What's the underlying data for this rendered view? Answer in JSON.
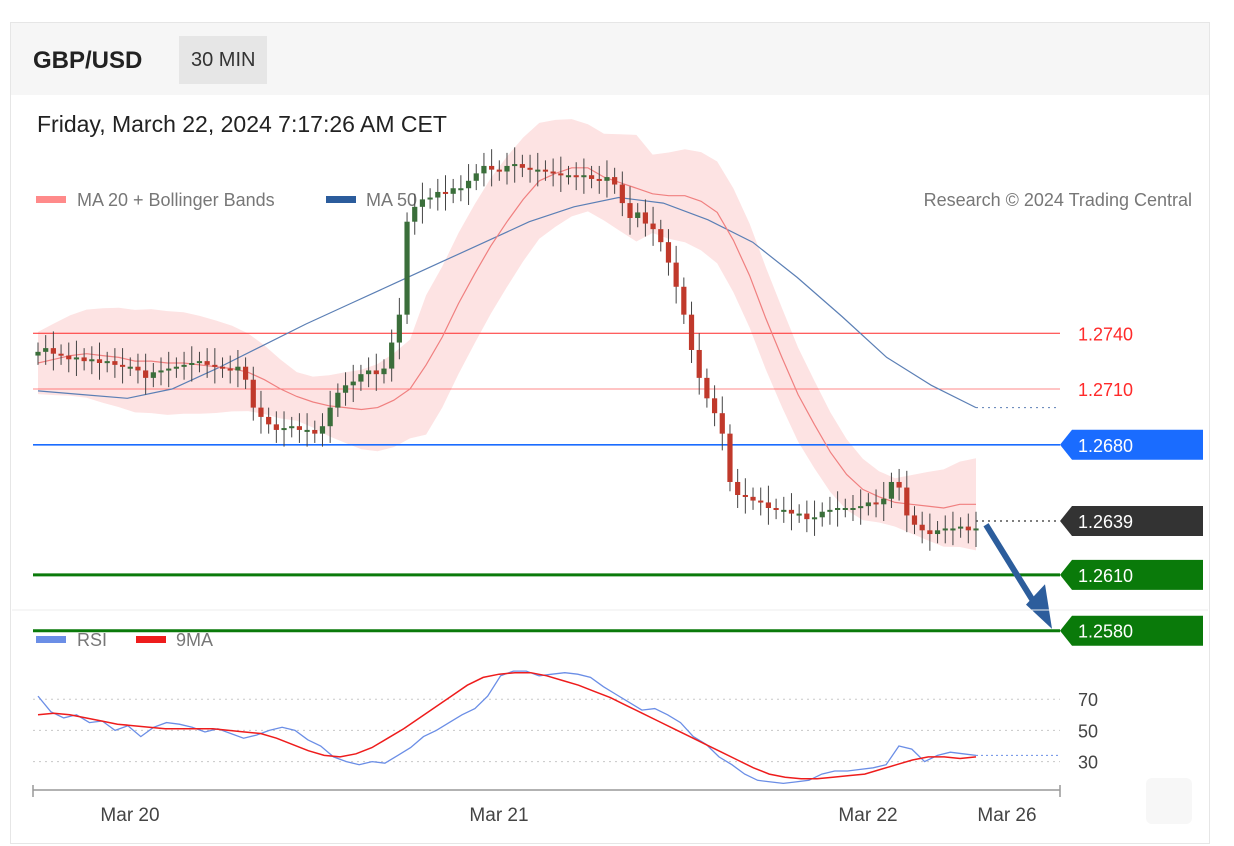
{
  "header": {
    "pair": "GBP/USD",
    "timeframe": "30 MIN",
    "datetime": "Friday, March 22, 2024 7:17:26 AM CET"
  },
  "legend": {
    "ma20": "MA 20 + Bollinger Bands",
    "ma50": "MA 50",
    "copyright": "Research © 2024 Trading Central",
    "rsi": "RSI",
    "rsi_ma": "9MA"
  },
  "colors": {
    "bollinger_fill": "#fde3e3",
    "ma20": "#f08080",
    "ma50": "#5b7fb5",
    "candle_up": "#3a6e3a",
    "candle_down": "#c0392b",
    "resistance": "#ff2a2a",
    "pivot": "#1a6cff",
    "support": "#0a7a0a",
    "current": "#333333",
    "arrow": "#2c5d9c",
    "rsi": "#6b8ee6",
    "rsi_ma": "#ee1c1c"
  },
  "chart_data": [
    {
      "type": "candlestick",
      "title": "GBP/USD",
      "timeframe": "30 MIN",
      "x_labels": [
        "Mar 20",
        "Mar 21",
        "Mar 22",
        "Mar 26"
      ],
      "ylim": [
        1.2575,
        1.2795
      ],
      "levels": [
        {
          "label": "1.2740",
          "value": 1.274,
          "kind": "resistance"
        },
        {
          "label": "1.2710",
          "value": 1.271,
          "kind": "resistance"
        },
        {
          "label": "1.2680",
          "value": 1.268,
          "kind": "pivot"
        },
        {
          "label": "1.2639",
          "value": 1.2639,
          "kind": "current"
        },
        {
          "label": "1.2610",
          "value": 1.261,
          "kind": "support"
        },
        {
          "label": "1.2580",
          "value": 1.258,
          "kind": "support"
        }
      ],
      "close_series": [
        1.273,
        1.2732,
        1.2729,
        1.2728,
        1.2726,
        1.2727,
        1.2725,
        1.2726,
        1.2724,
        1.2725,
        1.2723,
        1.2722,
        1.2722,
        1.272,
        1.2716,
        1.2719,
        1.272,
        1.2721,
        1.2722,
        1.2723,
        1.2724,
        1.2725,
        1.2723,
        1.2722,
        1.2721,
        1.272,
        1.2722,
        1.2715,
        1.27,
        1.2695,
        1.2691,
        1.2688,
        1.2689,
        1.269,
        1.2688,
        1.2688,
        1.2686,
        1.269,
        1.27,
        1.2708,
        1.2712,
        1.2714,
        1.2718,
        1.272,
        1.2718,
        1.2721,
        1.2735,
        1.275,
        1.28,
        1.2808,
        1.2812,
        1.2813,
        1.2816,
        1.2815,
        1.2818,
        1.2818,
        1.2822,
        1.2826,
        1.283,
        1.2828,
        1.2827,
        1.283,
        1.2831,
        1.2829,
        1.2828,
        1.2828,
        1.2827,
        1.2826,
        1.2825,
        1.2825,
        1.2824,
        1.2825,
        1.2823,
        1.2822,
        1.2824,
        1.282,
        1.281,
        1.2802,
        1.2805,
        1.2799,
        1.2796,
        1.2789,
        1.2778,
        1.2765,
        1.275,
        1.2731,
        1.2716,
        1.2705,
        1.2697,
        1.2686,
        1.266,
        1.2653,
        1.2652,
        1.265,
        1.2649,
        1.2646,
        1.2645,
        1.2645,
        1.2643,
        1.2643,
        1.264,
        1.2641,
        1.2644,
        1.2645,
        1.2646,
        1.2646,
        1.2646,
        1.2647,
        1.2649,
        1.2648,
        1.2651,
        1.266,
        1.2657,
        1.2642,
        1.2637,
        1.2634,
        1.2632,
        1.2634,
        1.2635,
        1.2635,
        1.2636,
        1.2634,
        1.2635
      ],
      "ma20": [
        1.2724,
        1.2726,
        1.2728,
        1.2729,
        1.2728,
        1.2727,
        1.2725,
        1.2725,
        1.2724,
        1.2724,
        1.2723,
        1.2722,
        1.2721,
        1.2719,
        1.2715,
        1.271,
        1.2706,
        1.2703,
        1.2701,
        1.27,
        1.2699,
        1.27,
        1.2704,
        1.271,
        1.2723,
        1.2738,
        1.2756,
        1.2772,
        1.2787,
        1.28,
        1.2812,
        1.2822,
        1.2826,
        1.2829,
        1.2829,
        1.2824,
        1.2821,
        1.2818,
        1.2815,
        1.2814,
        1.2814,
        1.2811,
        1.2805,
        1.279,
        1.2771,
        1.2748,
        1.2727,
        1.2707,
        1.2691,
        1.2676,
        1.2664,
        1.2656,
        1.2652,
        1.2649,
        1.2648,
        1.2647,
        1.2646,
        1.2648,
        1.2648
      ],
      "ma50": [
        1.2709,
        1.2707,
        1.2705,
        1.271,
        1.2721,
        1.2733,
        1.2745,
        1.2756,
        1.2767,
        1.2778,
        1.2789,
        1.28,
        1.2808,
        1.2813,
        1.281,
        1.2801,
        1.2789,
        1.277,
        1.2749,
        1.2727,
        1.2712,
        1.27
      ]
    },
    {
      "type": "line",
      "title": "RSI",
      "ylim": [
        15,
        90
      ],
      "yticks": [
        30,
        50,
        70
      ],
      "series": [
        {
          "name": "RSI",
          "values": [
            72,
            62,
            58,
            60,
            55,
            56,
            50,
            53,
            46,
            52,
            55,
            54,
            52,
            49,
            51,
            48,
            45,
            47,
            50,
            52,
            50,
            44,
            40,
            33,
            30,
            28,
            30,
            29,
            34,
            39,
            46,
            50,
            55,
            60,
            64,
            72,
            85,
            88,
            88,
            85,
            86,
            87,
            86,
            84,
            78,
            73,
            68,
            63,
            64,
            60,
            55,
            46,
            41,
            33,
            28,
            22,
            18,
            17,
            16,
            17,
            18,
            22,
            24,
            24,
            25,
            26,
            28,
            40,
            38,
            30,
            34,
            36,
            35,
            34
          ]
        },
        {
          "name": "9MA",
          "values": [
            60,
            61,
            60,
            58,
            56,
            54,
            53,
            52,
            51,
            51,
            51,
            51,
            50,
            49,
            48,
            45,
            41,
            37,
            34,
            33,
            35,
            39,
            45,
            51,
            58,
            65,
            72,
            79,
            84,
            86,
            87,
            87,
            85,
            82,
            79,
            75,
            71,
            66,
            61,
            56,
            51,
            46,
            41,
            36,
            31,
            26,
            22,
            20,
            19,
            19,
            20,
            21,
            22,
            25,
            28,
            31,
            33,
            33,
            32,
            33
          ]
        }
      ]
    }
  ]
}
